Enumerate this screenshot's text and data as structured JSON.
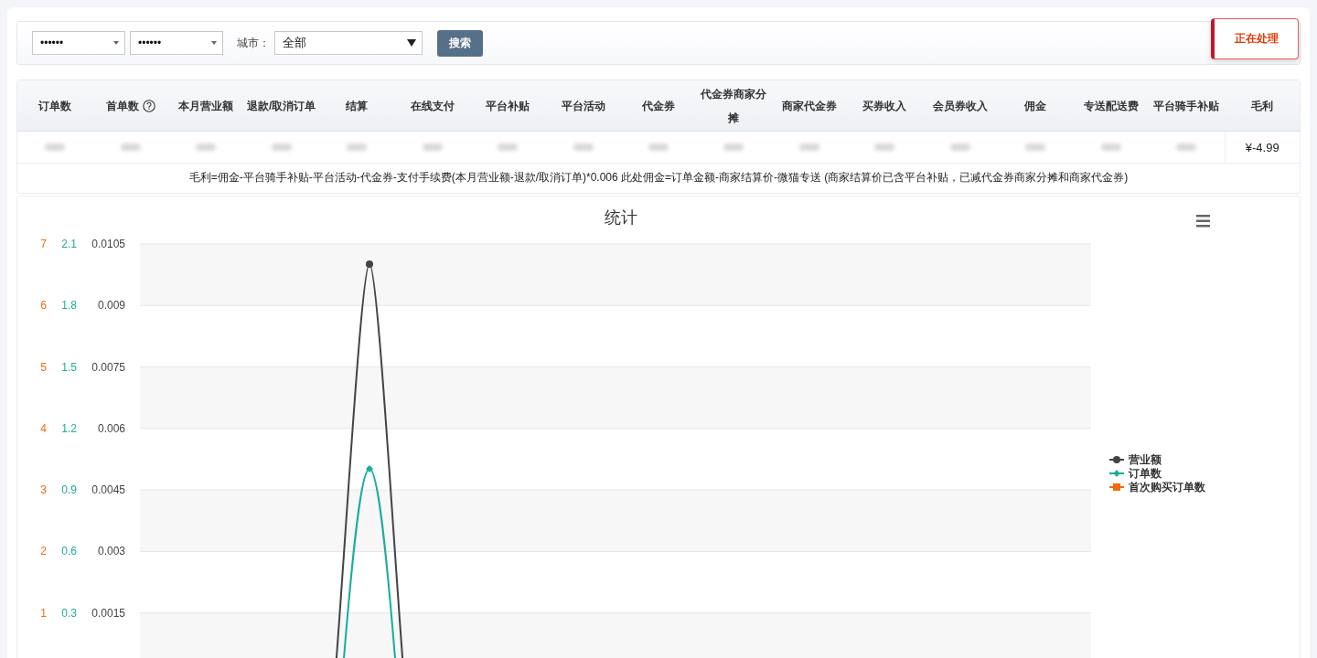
{
  "filters": {
    "selects": [
      {
        "value": "••••••"
      },
      {
        "value": "••••••"
      }
    ],
    "city_label": "城市：",
    "city_select": {
      "value": "全部"
    },
    "search_button": "搜索"
  },
  "status_button": "正在处理",
  "table": {
    "columns": [
      {
        "label": "订单数"
      },
      {
        "label": "首单数",
        "help": true
      },
      {
        "label": "本月营业额"
      },
      {
        "label": "退款/取消订单"
      },
      {
        "label": "结算"
      },
      {
        "label": "在线支付"
      },
      {
        "label": "平台补贴"
      },
      {
        "label": "平台活动"
      },
      {
        "label": "代金券"
      },
      {
        "label": "代金券商家分摊"
      },
      {
        "label": "商家代金券"
      },
      {
        "label": "买券收入"
      },
      {
        "label": "会员券收入"
      },
      {
        "label": "佣金"
      },
      {
        "label": "专送配送费"
      },
      {
        "label": "平台骑手补贴"
      },
      {
        "label": "毛利"
      }
    ],
    "rows": [
      {
        "cells": [
          {
            "redacted": true
          },
          {
            "redacted": true
          },
          {
            "redacted": true
          },
          {
            "redacted": true
          },
          {
            "redacted": true
          },
          {
            "redacted": true
          },
          {
            "redacted": true
          },
          {
            "redacted": true
          },
          {
            "redacted": true
          },
          {
            "redacted": true
          },
          {
            "redacted": true
          },
          {
            "redacted": true
          },
          {
            "redacted": true
          },
          {
            "redacted": true
          },
          {
            "redacted": true
          },
          {
            "redacted": true
          },
          {
            "redacted": false,
            "text": "¥-4.99"
          }
        ]
      }
    ]
  },
  "formula_note": "毛利=佣金-平台骑手补贴-平台活动-代金券-支付手续费(本月营业额-退款/取消订单)*0.006  此处佣金=订单金额-商家结算价-微猫专送 (商家结算价已含平台补贴，已减代金券商家分摊和商家代金券)",
  "chart": {
    "title": "统计",
    "legend": [
      {
        "name": "营业额",
        "color": "#434348",
        "kind": "circle"
      },
      {
        "name": "订单数",
        "color": "#1aad9a",
        "kind": "diamond"
      },
      {
        "name": "首次购买订单数",
        "color": "#f26a10",
        "kind": "square"
      }
    ],
    "axes": [
      {
        "color": "#f26a10",
        "ticks": [
          "7",
          "6",
          "5",
          "4",
          "3",
          "2",
          "1"
        ]
      },
      {
        "color": "#1aad9a",
        "ticks": [
          "2.1",
          "1.8",
          "1.5",
          "1.2",
          "0.9",
          "0.6",
          "0.3"
        ]
      },
      {
        "color": "#434348",
        "ticks": [
          "0.0105",
          "0.009",
          "0.0075",
          "0.006",
          "0.0045",
          "0.003",
          "0.0015"
        ]
      }
    ]
  }
}
